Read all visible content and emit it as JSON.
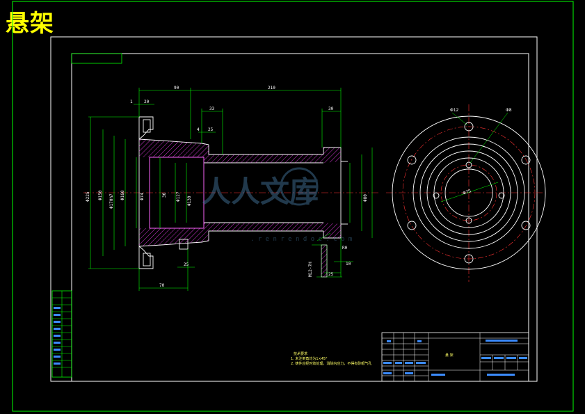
{
  "title": "悬架",
  "front_view": {
    "dims_top": [
      "90",
      "210",
      "1",
      "20",
      "4",
      "25",
      "33",
      "30"
    ],
    "dims_vertical": [
      "Φ225",
      "Φ150",
      "Φ170h7",
      "Φ160",
      "Φ130",
      "Φ74",
      "36",
      "Φ127",
      "Φ80"
    ],
    "dims_bottom": [
      "25",
      "70",
      "R0",
      "25",
      "10"
    ],
    "thread_note": "M12-7H"
  },
  "side_view": {
    "labels": [
      "Φ12",
      "Φ8",
      "Φ75"
    ]
  },
  "watermark": {
    "text": "人人文库",
    "subtext": ". r e n r e n d o c . c o m"
  },
  "tech_notes": {
    "heading": "技术要求",
    "lines": [
      "1. 未注倒角均为1×45°",
      "2. 铸件应经时效处理，消除内应力，不得有砂眼气孔"
    ]
  },
  "title_block": {
    "name": "悬 架"
  }
}
